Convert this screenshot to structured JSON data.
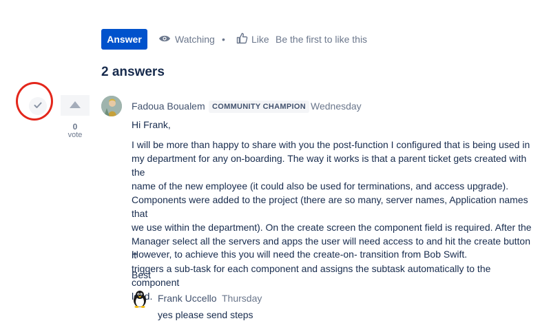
{
  "actions": {
    "answer_label": "Answer",
    "watching_label": "Watching",
    "separator": "•",
    "like_label": "Like",
    "like_hint": "Be the first to like this"
  },
  "answers_heading": "2 answers",
  "answer": {
    "vote_count": "0",
    "vote_label": "vote",
    "author": "Fadoua Boualem",
    "badge": "COMMUNITY CHAMPION",
    "date": "Wednesday",
    "greeting": "Hi Frank,",
    "paragraph1_lines": [
      "I will be more than happy to share with you the post-function I configured that is being used in",
      "my department for any on-boarding. The way it works is that a parent ticket gets created with the",
      "name of the new employee (it could also be used for terminations, and access upgrade).",
      "Components were added to the project (there are so many, server names, Application names that",
      "we use within the department). On the create screen the component field is required. After the",
      "Manager select all the servers and apps the user will need access to and hit the create button it",
      "triggers a sub-task for each component and assigns the subtask automatically to the component",
      "lead."
    ],
    "paragraph2": "However, to achieve this you will need the create-on- transition from Bob Swift.",
    "signoff": "Best"
  },
  "reply": {
    "author": "Frank Uccello",
    "date": "Thursday",
    "text": "yes please send steps"
  },
  "colors": {
    "primary": "#0052cc",
    "highlight_ring": "#e3261b",
    "muted_text": "#6b778c",
    "body_text": "#172b4d"
  }
}
